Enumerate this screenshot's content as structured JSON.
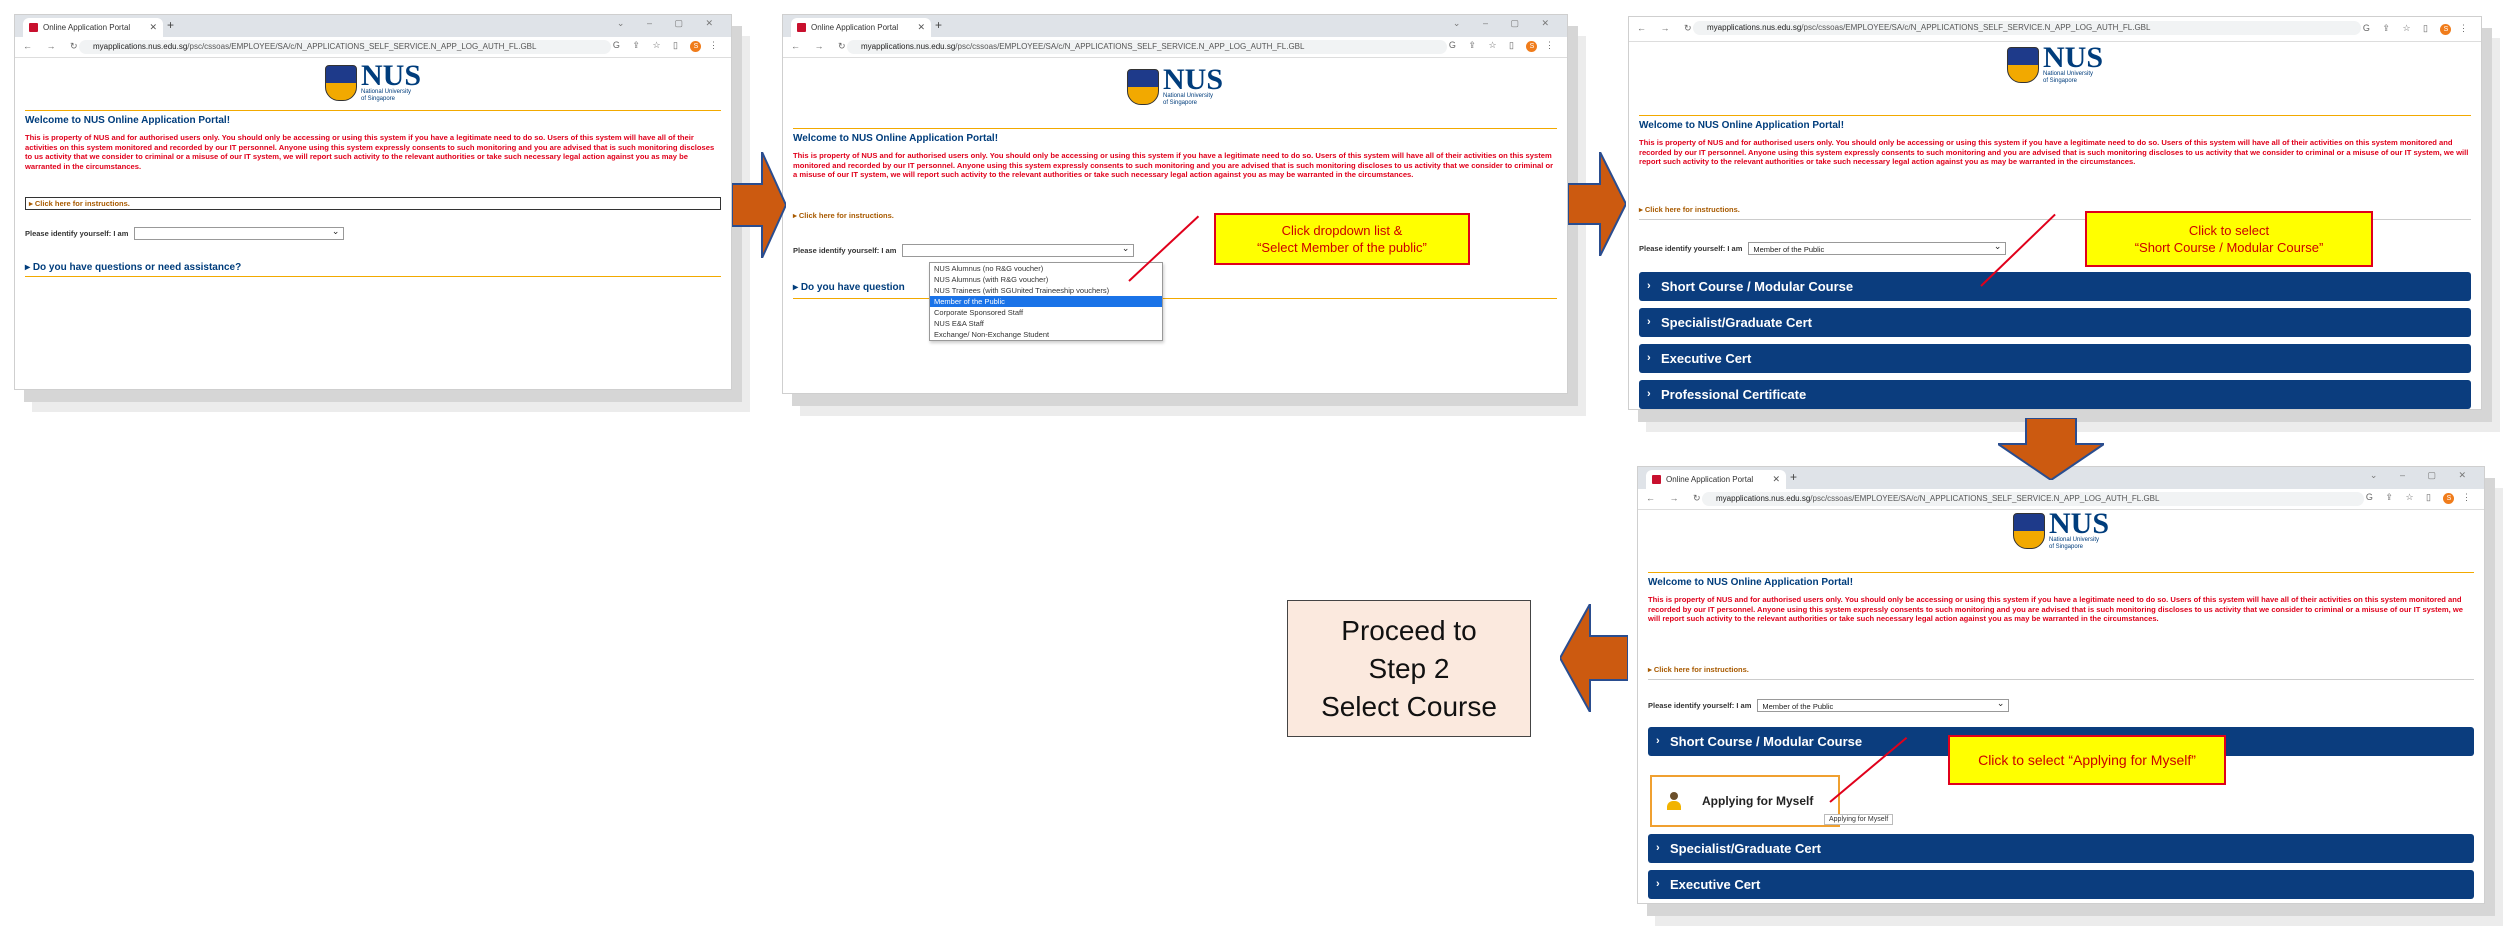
{
  "browser": {
    "tab_title": "Online Application Portal",
    "url_host": "myapplications.nus.edu.sg",
    "url_path": "/psc/cssoas/EMPLOYEE/SA/c/N_APPLICATIONS_SELF_SERVICE.N_APP_LOG_AUTH_FL.GBL",
    "profile_initial": "S"
  },
  "logo": {
    "name": "NUS",
    "sub1": "National University",
    "sub2": "of Singapore"
  },
  "portal": {
    "welcome": "Welcome to NUS Online Application Portal!",
    "warning": "This is property of NUS and for authorised users only. You should only be accessing or using this system if you have a legitimate need to do so. Users of this system will have all of their activities on this system monitored and recorded by our IT personnel. Anyone using this system expressly consents to such monitoring and you are advised that is such monitoring discloses to us activity that we consider to criminal or a misuse of our IT system, we will report such activity to the relevant authorities or take such necessary legal action against you as may be warranted in the circumstances.",
    "instructions_link": "Click here for instructions.",
    "identify_label": "Please identify yourself: I am",
    "selected_value": "Member of the Public",
    "question": "Do you have questions or need assistance?",
    "question_short": "Do you have question"
  },
  "dropdown_options": [
    "NUS Alumnus (no R&G voucher)",
    "NUS Alumnus (with R&G voucher)",
    "NUS Trainees (with SGUnited Traineeship vouchers)",
    "Member of the Public",
    "Corporate Sponsored Staff",
    "NUS E&A Staff",
    "Exchange/ Non-Exchange Student"
  ],
  "courses": [
    "Short Course / Modular Course",
    "Specialist/Graduate Cert",
    "Executive Cert",
    "Professional Certificate"
  ],
  "apply_button": "Applying for Myself",
  "apply_tooltip": "Applying for Myself",
  "callouts": {
    "c1_line1": "Click dropdown list &",
    "c1_line2": "“Select Member of the public”",
    "c2_line1": "Click to select",
    "c2_line2": "“Short Course / Modular Course”",
    "c3": "Click to select  “Applying for Myself”"
  },
  "step2": {
    "line1": "Proceed to",
    "line2": "Step 2",
    "line3": "Select Course"
  },
  "colors": {
    "nus_blue": "#0b3d7e",
    "warning_red": "#e0001b",
    "arrow_orange": "#cc5a10",
    "callout_yellow": "#ffff00"
  }
}
